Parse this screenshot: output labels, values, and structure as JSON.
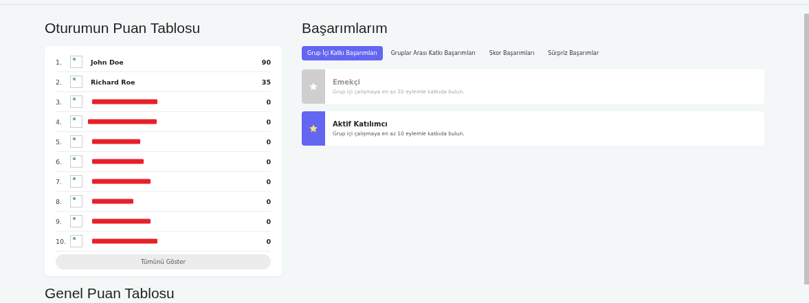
{
  "session_board": {
    "title": "Oturumun Puan Tablosu",
    "rows": [
      {
        "kind": "named",
        "rank": "1.",
        "name": "John Doe",
        "score": "90"
      },
      {
        "kind": "named",
        "rank": "2.",
        "name": "Richard Roe",
        "score": "35"
      },
      {
        "kind": "redacted",
        "rank": "3.",
        "score": "0"
      },
      {
        "kind": "redacted",
        "rank": "4.",
        "score": "0"
      },
      {
        "kind": "redacted",
        "rank": "5.",
        "score": "0"
      },
      {
        "kind": "redacted",
        "rank": "6.",
        "score": "0"
      },
      {
        "kind": "redacted",
        "rank": "7.",
        "score": "0"
      },
      {
        "kind": "redacted",
        "rank": "8.",
        "score": "0"
      },
      {
        "kind": "redacted",
        "rank": "9.",
        "score": "0"
      },
      {
        "kind": "redacted",
        "rank": "10.",
        "score": "0"
      }
    ],
    "show_all_button": "Tümünü Göster"
  },
  "general_board": {
    "title": "Genel Puan Tablosu"
  },
  "achievements": {
    "title": "Başarımlarım",
    "tabs": [
      {
        "label": "Grup İçi Katkı Başarımları",
        "selected": true
      },
      {
        "label": "Gruplar Arası Katkı Başarımları",
        "selected": false
      },
      {
        "label": "Skor Başarımları",
        "selected": false
      },
      {
        "label": "Sürpriz Başarımlar",
        "selected": false
      }
    ],
    "items": [
      {
        "title": "Emekçi",
        "description": "Grup içi çalışmaya en az 20 eylemle katkıda bulun.",
        "earned": false
      },
      {
        "title": "Aktif Katılımcı",
        "description": "Grup içi çalışmaya en az 10 eylemle katkıda bulun.",
        "earned": true
      }
    ]
  }
}
